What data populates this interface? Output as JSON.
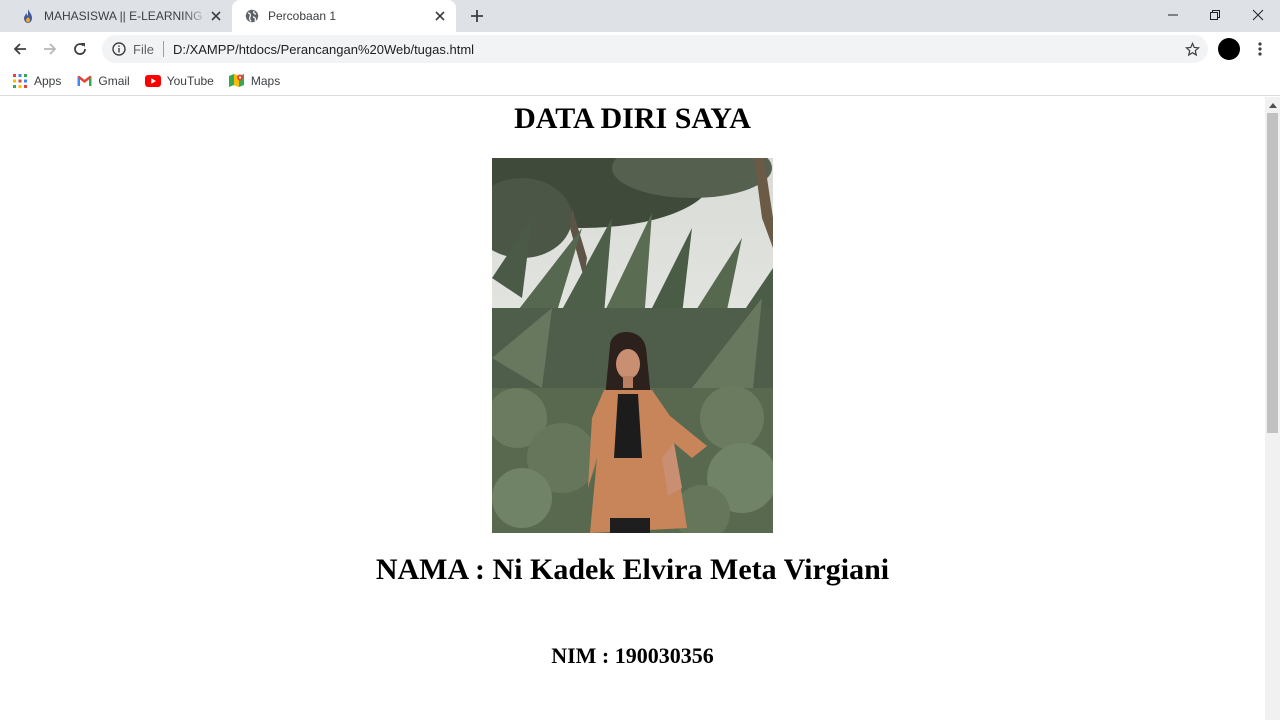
{
  "browser": {
    "tabs": [
      {
        "title": "MAHASISWA || E-LEARNING STIKOM",
        "favicon": "flame-icon",
        "active": false
      },
      {
        "title": "Percobaan 1",
        "favicon": "globe-icon",
        "active": true
      }
    ],
    "address": {
      "scheme_label": "File",
      "url": "D:/XAMPP/htdocs/Perancangan%20Web/tugas.html"
    },
    "bookmarks": [
      {
        "label": "Apps",
        "icon": "apps-grid-icon"
      },
      {
        "label": "Gmail",
        "icon": "gmail-icon"
      },
      {
        "label": "YouTube",
        "icon": "youtube-icon"
      },
      {
        "label": "Maps",
        "icon": "maps-icon"
      }
    ]
  },
  "page": {
    "title": "DATA DIRI SAYA",
    "name_line": "NAMA : Ni Kadek Elvira Meta Virgiani",
    "nim_line": "NIM : 190030356"
  },
  "colors": {
    "tabstrip": "#dee1e6",
    "omnibox": "#f1f3f4",
    "youtube_red": "#ff0000"
  }
}
